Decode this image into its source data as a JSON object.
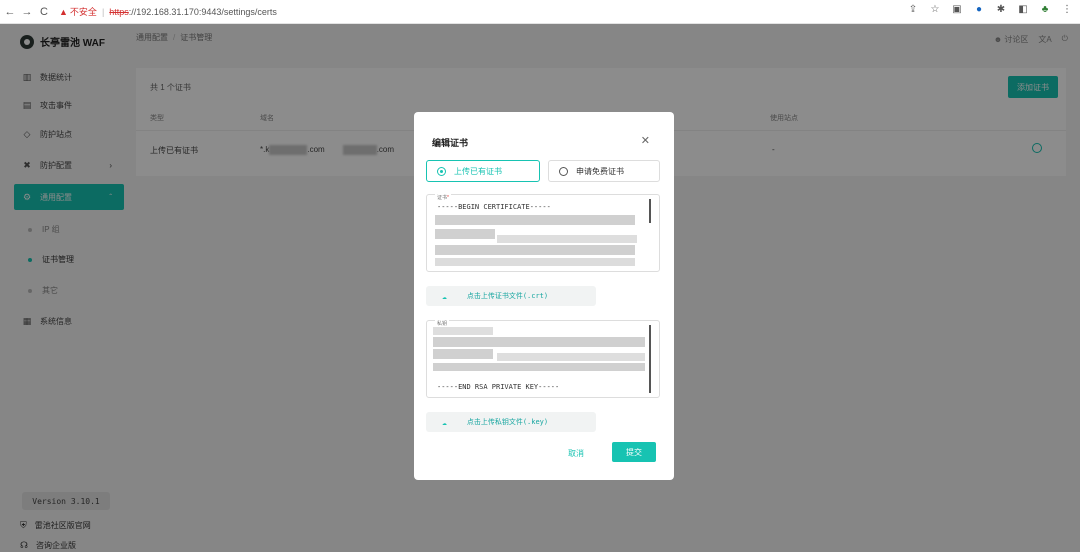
{
  "browser": {
    "back": "←",
    "forward": "→",
    "reload": "C",
    "insecure": "不安全",
    "scheme": "https",
    "url_rest": "://192.168.31.170:9443/settings/certs"
  },
  "sidebar": {
    "logo": "长亭雷池 WAF",
    "items": [
      {
        "label": "数据统计",
        "icon": "chart-icon"
      },
      {
        "label": "攻击事件",
        "icon": "event-icon"
      },
      {
        "label": "防护站点",
        "icon": "shield-icon"
      },
      {
        "label": "防护配置",
        "icon": "tools-icon"
      },
      {
        "label": "通用配置",
        "icon": "settings-icon"
      }
    ],
    "sub_items": [
      {
        "label": "IP 组"
      },
      {
        "label": "证书管理"
      },
      {
        "label": "其它"
      }
    ],
    "system_info": "系统信息",
    "version": "Version 3.10.1",
    "footer_links": [
      {
        "label": "雷池社区版官网"
      },
      {
        "label": "咨询企业版"
      }
    ]
  },
  "header": {
    "breadcrumb_parent": "通用配置",
    "breadcrumb_current": "证书管理",
    "forum": "讨论区"
  },
  "main": {
    "count_text": "共 1 个证书",
    "add_button": "添加证书",
    "columns": [
      "类型",
      "域名",
      "使用站点"
    ],
    "row": {
      "type": "上传已有证书",
      "domain_prefix": "*.k",
      "domain_suffix1": ".com",
      "domain_suffix2": ".com",
      "used_sites": "-"
    }
  },
  "modal": {
    "title": "编辑证书",
    "option_upload": "上传已有证书",
    "option_free": "申请免费证书",
    "cert_label": "证书",
    "cert_begin": "-----BEGIN CERTIFICATE-----",
    "upload_cert": "点击上传证书文件(.crt)",
    "key_label": "私钥",
    "key_end": "-----END RSA PRIVATE KEY-----",
    "upload_key": "点击上传私钥文件(.key)",
    "cancel": "取消",
    "submit": "提交"
  },
  "colors": {
    "accent": "#17c3b2",
    "danger": "#d32f2f"
  }
}
